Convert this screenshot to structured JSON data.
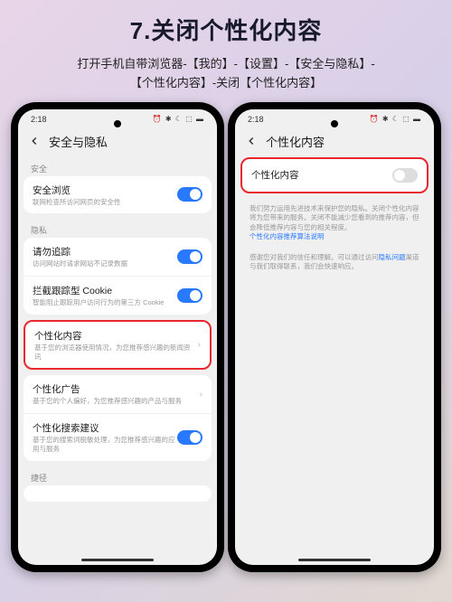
{
  "title": "7.关闭个性化内容",
  "instructions_line1": "打开手机自带浏览器-【我的】-【设置】-【安全与隐私】-",
  "instructions_line2": "【个性化内容】-关闭【个性化内容】",
  "status": {
    "time": "2:18",
    "icons": "⏰ ✱ ☾ ⬚ ▬"
  },
  "left": {
    "header": "安全与隐私",
    "sec_security": "安全",
    "safe_browse": {
      "title": "安全浏览",
      "sub": "联网检查所访问网页的安全性"
    },
    "sec_privacy": "隐私",
    "dnt": {
      "title": "请勿追踪",
      "sub": "访问网站时请求网站不记录数据"
    },
    "cookie": {
      "title": "拦截跟踪型 Cookie",
      "sub": "智能阻止跟踪用户访问行为的第三方 Cookie"
    },
    "pcontent": {
      "title": "个性化内容",
      "sub": "基于您的浏览器使用情况，为您推荐感兴趣的新闻资讯"
    },
    "pads": {
      "title": "个性化广告",
      "sub": "基于您的个人偏好，为您推荐感兴趣的产品与服务"
    },
    "psearch": {
      "title": "个性化搜索建议",
      "sub": "基于您的搜索词脱敏处理，为您推荐感兴趣的应用与服务"
    },
    "sec_shortcut": "捷径"
  },
  "right": {
    "header": "个性化内容",
    "toggle_label": "个性化内容",
    "desc1_a": "我们努力运用先进技术来保护您的隐私。关闭个性化内容将为您带来的服务。关闭不能减少您看到的推荐内容，但会降低推荐内容与您的相关程度。",
    "desc1_link": "个性化内容推荐算法说明",
    "desc2_a": "感谢您对我们的信任和理解。可以通过访问",
    "desc2_link": "隐私问题",
    "desc2_b": "渠道与我们取得联系，我们会快速响应。"
  }
}
